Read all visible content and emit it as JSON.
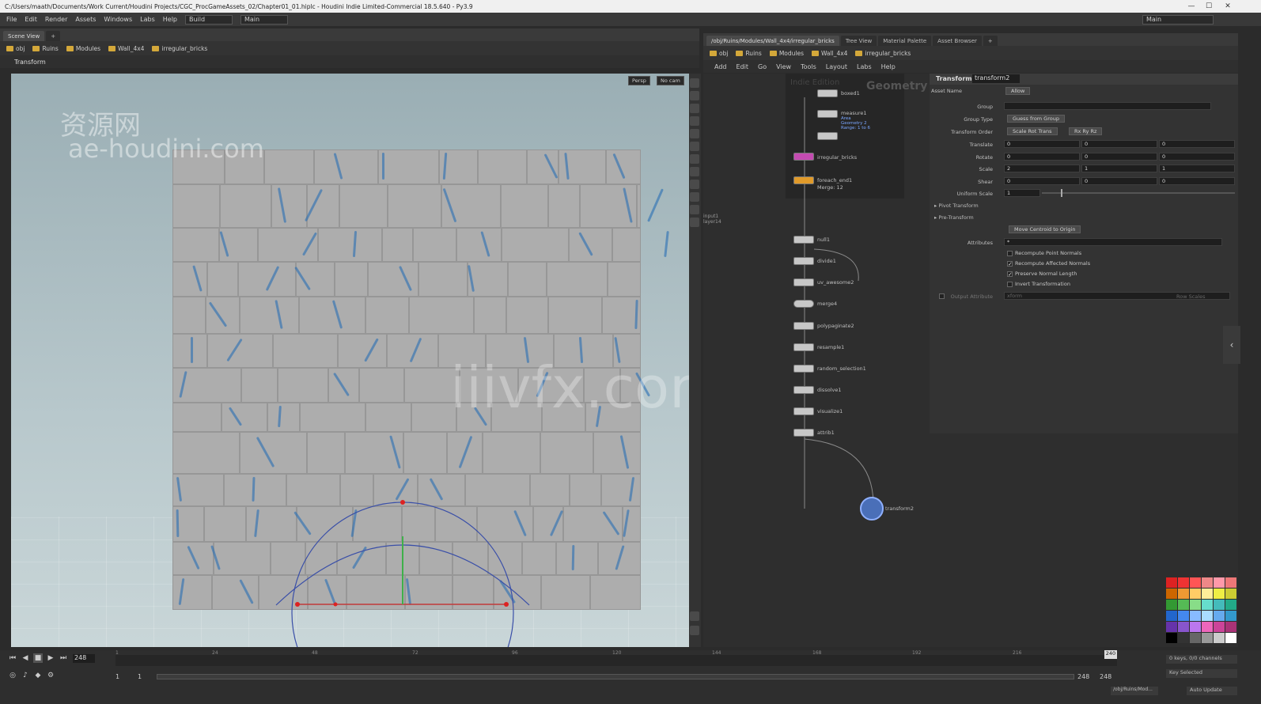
{
  "window": {
    "title": "C:/Users/maath/Documents/Work Current/Houdini Projects/CGC_ProcGameAssets_02/Chapter01_01.hiplc - Houdini Indie Limited-Commercial 18.5.640 - Py3.9",
    "minimize": "—",
    "maximize": "☐",
    "close": "✕"
  },
  "menu": {
    "items": [
      "File",
      "Edit",
      "Render",
      "Assets",
      "Windows",
      "Labs",
      "Help"
    ],
    "desktop_dropdown": "Build",
    "desktop_dropdown2": "Main",
    "right_dropdown": "Main"
  },
  "left_pane": {
    "tab": "Scene View",
    "path": [
      "obj",
      "Ruins",
      "Modules",
      "Wall_4x4",
      "irregular_bricks"
    ],
    "viewport_title": "Transform",
    "persp_label": "Persp",
    "cam_label": "No cam"
  },
  "watermarks": {
    "cn": "资源网",
    "url": "ae-houdini.com",
    "center": "iiivfx.com"
  },
  "right_pane": {
    "tabs": [
      "/obj/Ruins/Modules/Wall_4x4/irregular_bricks",
      "Tree View",
      "Material Palette",
      "Asset Browser"
    ],
    "path": [
      "obj",
      "Ruins",
      "Modules",
      "Wall_4x4",
      "irregular_bricks"
    ],
    "menu": [
      "Add",
      "Edit",
      "Go",
      "View",
      "Tools",
      "Layout",
      "Labs",
      "Help"
    ],
    "net_badge": "Geometry",
    "net_badge2": "Indie Edition"
  },
  "nodes": [
    {
      "label": "boxed1"
    },
    {
      "label": "measure1",
      "sub": "Area\nGeometry 2\nRange: 1 to 6"
    },
    {
      "label": "irregular_bricks"
    },
    {
      "label": "foreach_end1",
      "sub": "Merge: 12"
    },
    {
      "label": "null1"
    },
    {
      "label": "divide1"
    },
    {
      "label": "uv_awesome2"
    },
    {
      "label": "merge4"
    },
    {
      "label": "polypaginate2"
    },
    {
      "label": "resample1"
    },
    {
      "label": "random_selection1"
    },
    {
      "label": "dissolve1"
    },
    {
      "label": "visualize1"
    },
    {
      "label": "attrib1"
    },
    {
      "label": "transform2"
    }
  ],
  "side_label": "input1\nlayer14",
  "params": {
    "node_type": "Transform",
    "node_name": "transform2",
    "asset_name_label": "Asset Name",
    "asset_name_value": "Allow",
    "group_label": "Group",
    "group_type_label": "Group Type",
    "group_type_value": "Guess from Group",
    "xform_order_label": "Transform Order",
    "xform_order_value": "Scale Rot Trans",
    "rot_order_value": "Rx Ry Rz",
    "translate_label": "Translate",
    "translate": [
      "0",
      "0",
      "0"
    ],
    "rotate_label": "Rotate",
    "rotate": [
      "0",
      "0",
      "0"
    ],
    "scale_label": "Scale",
    "scale": [
      "2",
      "1",
      "1"
    ],
    "shear_label": "Shear",
    "shear": [
      "0",
      "0",
      "0"
    ],
    "uniform_scale_label": "Uniform Scale",
    "uniform_scale": "1",
    "pivot_transform": "Pivot Transform",
    "pre_transform": "Pre-Transform",
    "move_centroid": "Move Centroid to Origin",
    "attributes_label": "Attributes",
    "attributes_value": "*",
    "cb1": "Recompute Point Normals",
    "cb2": "Recompute Affected Normals",
    "cb3": "Preserve Normal Length",
    "cb4": "Invert Transformation",
    "output_attr_label": "Output Attribute",
    "output_attr_value": "xform",
    "output_attr_right": "Row Scales"
  },
  "timeline": {
    "current_frame": "248",
    "ticks": [
      "1",
      "24",
      "48",
      "72",
      "96",
      "120",
      "144",
      "168",
      "192",
      "216",
      "240"
    ],
    "end_marker": "240",
    "start_a": "1",
    "start_b": "1",
    "end_a": "248",
    "end_b": "248",
    "keys_info": "0 keys, 0/0 channels",
    "key_selected": "Key Selected",
    "auto_update": "Auto Update",
    "status_left": "/obj/Ruins/Mod..."
  },
  "colors": {
    "accent": "#2f7fd1",
    "viewport_bg": "#aebfc4",
    "wall": "#adadad",
    "node_pink": "#c44bb1",
    "node_orange": "#e09a2a",
    "transform_node": "#4a6fb8"
  }
}
